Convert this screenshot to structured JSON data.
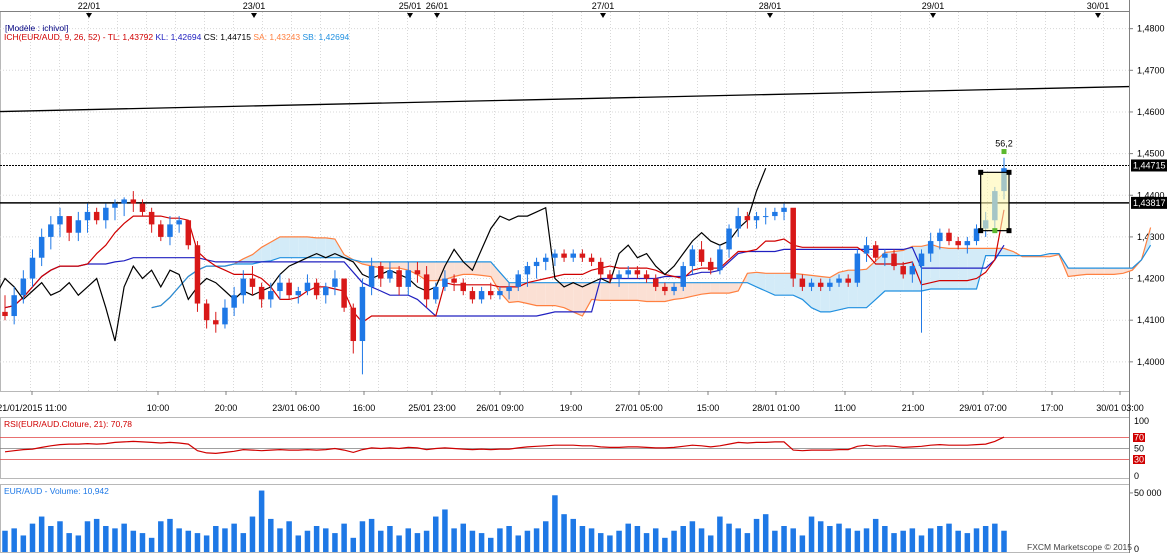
{
  "chart_data": [
    {
      "type": "candlestick",
      "title": "",
      "info_lines": [
        {
          "parts": [
            {
              "text": "[Modèle : ichivol]",
              "color": "#000080"
            }
          ]
        },
        {
          "parts": [
            {
              "text": "ICH(EUR/AUD, 9, 26, 52) - TL: 1,43792",
              "color": "#d00000"
            },
            {
              "text": "KL: 1,42694",
              "color": "#2020c0"
            },
            {
              "text": "CS: 1,44715",
              "color": "#000000"
            },
            {
              "text": "SA: 1,43243",
              "color": "#ff8040"
            },
            {
              "text": "SB: 1,42694",
              "color": "#2090e0"
            }
          ]
        }
      ],
      "top_dates": [
        "22/01",
        "23/01",
        "25/01",
        "26/01",
        "27/01",
        "28/01",
        "29/01",
        "30/01"
      ],
      "x_time_labels": [
        "21/01/2015 11:00",
        "10:00",
        "20:00",
        "23/01 06:00",
        "16:00",
        "25/01 23:00",
        "26/01 09:00",
        "19:00",
        "27/01 05:00",
        "15:00",
        "28/01 01:00",
        "11:00",
        "21:00",
        "29/01 07:00",
        "17:00",
        "30/01 03:00"
      ],
      "y_ticks": [
        "1,4800",
        "1,4700",
        "1,4600",
        "1,4500",
        "1,4400",
        "1,4300",
        "1,4200",
        "1,4100",
        "1,4000"
      ],
      "y_tick_values": [
        1.48,
        1.47,
        1.46,
        1.45,
        1.44,
        1.43,
        1.42,
        1.41,
        1.4
      ],
      "ylim": [
        1.393,
        1.484
      ],
      "price_tags": [
        {
          "text": "1,44715",
          "value": 1.44715,
          "bg": "#000000",
          "fg": "#ffffff"
        },
        {
          "text": "1,43817",
          "value": 1.43817,
          "bg": "#000000",
          "fg": "#ffffff"
        }
      ],
      "annotation": {
        "text": "56,2",
        "value": 1.4515
      },
      "horizontal_lines": [
        1.44715,
        1.43817
      ],
      "trendline": {
        "from": 1.4601,
        "to": 1.4661
      },
      "colors": {
        "up": "#1e78e6",
        "down": "#d81818",
        "tenkan": "#d00000",
        "kijun": "#2020c0",
        "chikou": "#000000",
        "span_a": "#ff8040",
        "span_b": "#2090e0",
        "cloud_bull": "#d3ebf8",
        "cloud_bear": "#fbe0d4"
      },
      "candles_ohlc": [
        [
          1.412,
          1.416,
          1.41,
          1.411
        ],
        [
          1.411,
          1.418,
          1.409,
          1.416
        ],
        [
          1.416,
          1.422,
          1.414,
          1.42
        ],
        [
          1.42,
          1.427,
          1.418,
          1.425
        ],
        [
          1.425,
          1.432,
          1.423,
          1.43
        ],
        [
          1.43,
          1.435,
          1.427,
          1.433
        ],
        [
          1.433,
          1.437,
          1.43,
          1.435
        ],
        [
          1.435,
          1.433,
          1.429,
          1.431
        ],
        [
          1.431,
          1.436,
          1.429,
          1.434
        ],
        [
          1.434,
          1.438,
          1.431,
          1.436
        ],
        [
          1.436,
          1.437,
          1.433,
          1.434
        ],
        [
          1.434,
          1.438,
          1.432,
          1.437
        ],
        [
          1.437,
          1.439,
          1.434,
          1.438
        ],
        [
          1.438,
          1.4395,
          1.435,
          1.439
        ],
        [
          1.439,
          1.441,
          1.436,
          1.438
        ],
        [
          1.438,
          1.439,
          1.435,
          1.436
        ],
        [
          1.436,
          1.437,
          1.431,
          1.433
        ],
        [
          1.433,
          1.434,
          1.429,
          1.43
        ],
        [
          1.43,
          1.435,
          1.428,
          1.433
        ],
        [
          1.433,
          1.435,
          1.431,
          1.434
        ],
        [
          1.434,
          1.433,
          1.427,
          1.428
        ],
        [
          1.428,
          1.429,
          1.412,
          1.414
        ],
        [
          1.414,
          1.415,
          1.408,
          1.41
        ],
        [
          1.41,
          1.412,
          1.407,
          1.409
        ],
        [
          1.409,
          1.415,
          1.408,
          1.413
        ],
        [
          1.413,
          1.418,
          1.411,
          1.416
        ],
        [
          1.416,
          1.422,
          1.414,
          1.42
        ],
        [
          1.42,
          1.423,
          1.416,
          1.418
        ],
        [
          1.418,
          1.419,
          1.413,
          1.415
        ],
        [
          1.415,
          1.419,
          1.413,
          1.417
        ],
        [
          1.417,
          1.421,
          1.415,
          1.419
        ],
        [
          1.419,
          1.42,
          1.415,
          1.416
        ],
        [
          1.416,
          1.418,
          1.414,
          1.417
        ],
        [
          1.417,
          1.421,
          1.416,
          1.419
        ],
        [
          1.419,
          1.42,
          1.415,
          1.416
        ],
        [
          1.416,
          1.419,
          1.414,
          1.418
        ],
        [
          1.418,
          1.422,
          1.416,
          1.42
        ],
        [
          1.42,
          1.419,
          1.412,
          1.413
        ],
        [
          1.413,
          1.414,
          1.402,
          1.405
        ],
        [
          1.405,
          1.42,
          1.397,
          1.418
        ],
        [
          1.418,
          1.425,
          1.416,
          1.423
        ],
        [
          1.423,
          1.424,
          1.418,
          1.42
        ],
        [
          1.42,
          1.424,
          1.419,
          1.422
        ],
        [
          1.422,
          1.423,
          1.416,
          1.418
        ],
        [
          1.418,
          1.424,
          1.416,
          1.422
        ],
        [
          1.422,
          1.424,
          1.419,
          1.421
        ],
        [
          1.421,
          1.423,
          1.413,
          1.415
        ],
        [
          1.415,
          1.419,
          1.414,
          1.418
        ],
        [
          1.418,
          1.422,
          1.417,
          1.42
        ],
        [
          1.42,
          1.421,
          1.417,
          1.419
        ],
        [
          1.419,
          1.42,
          1.416,
          1.417
        ],
        [
          1.417,
          1.418,
          1.414,
          1.415
        ],
        [
          1.415,
          1.418,
          1.414,
          1.417
        ],
        [
          1.417,
          1.419,
          1.415,
          1.416
        ],
        [
          1.416,
          1.418,
          1.415,
          1.417
        ],
        [
          1.417,
          1.419,
          1.415,
          1.418
        ],
        [
          1.418,
          1.422,
          1.417,
          1.421
        ],
        [
          1.421,
          1.424,
          1.418,
          1.423
        ],
        [
          1.423,
          1.425,
          1.42,
          1.424
        ],
        [
          1.424,
          1.426,
          1.422,
          1.425
        ],
        [
          1.425,
          1.427,
          1.423,
          1.426
        ],
        [
          1.426,
          1.427,
          1.424,
          1.425
        ],
        [
          1.425,
          1.427,
          1.424,
          1.426
        ],
        [
          1.426,
          1.427,
          1.424,
          1.425
        ],
        [
          1.425,
          1.426,
          1.423,
          1.424
        ],
        [
          1.424,
          1.425,
          1.42,
          1.421
        ],
        [
          1.421,
          1.422,
          1.419,
          1.42
        ],
        [
          1.42,
          1.422,
          1.418,
          1.421
        ],
        [
          1.421,
          1.423,
          1.42,
          1.422
        ],
        [
          1.422,
          1.423,
          1.42,
          1.421
        ],
        [
          1.421,
          1.422,
          1.419,
          1.42
        ],
        [
          1.42,
          1.421,
          1.417,
          1.418
        ],
        [
          1.418,
          1.419,
          1.416,
          1.417
        ],
        [
          1.417,
          1.419,
          1.416,
          1.418
        ],
        [
          1.418,
          1.424,
          1.417,
          1.423
        ],
        [
          1.423,
          1.428,
          1.421,
          1.427
        ],
        [
          1.427,
          1.429,
          1.423,
          1.424
        ],
        [
          1.424,
          1.425,
          1.421,
          1.422
        ],
        [
          1.422,
          1.428,
          1.421,
          1.427
        ],
        [
          1.427,
          1.433,
          1.425,
          1.432
        ],
        [
          1.432,
          1.437,
          1.43,
          1.435
        ],
        [
          1.435,
          1.436,
          1.432,
          1.434
        ],
        [
          1.434,
          1.436,
          1.432,
          1.435
        ],
        [
          1.435,
          1.437,
          1.433,
          1.435
        ],
        [
          1.435,
          1.437,
          1.434,
          1.436
        ],
        [
          1.436,
          1.438,
          1.434,
          1.437
        ],
        [
          1.437,
          1.435,
          1.418,
          1.42
        ],
        [
          1.42,
          1.421,
          1.417,
          1.418
        ],
        [
          1.418,
          1.42,
          1.417,
          1.419
        ],
        [
          1.419,
          1.42,
          1.417,
          1.418
        ],
        [
          1.418,
          1.42,
          1.417,
          1.419
        ],
        [
          1.419,
          1.421,
          1.418,
          1.42
        ],
        [
          1.42,
          1.421,
          1.418,
          1.419
        ],
        [
          1.419,
          1.427,
          1.418,
          1.426
        ],
        [
          1.426,
          1.43,
          1.424,
          1.428
        ],
        [
          1.428,
          1.429,
          1.424,
          1.425
        ],
        [
          1.425,
          1.427,
          1.423,
          1.426
        ],
        [
          1.426,
          1.427,
          1.422,
          1.423
        ],
        [
          1.423,
          1.424,
          1.42,
          1.421
        ],
        [
          1.421,
          1.424,
          1.419,
          1.423
        ],
        [
          1.423,
          1.427,
          1.407,
          1.426
        ],
        [
          1.426,
          1.431,
          1.424,
          1.429
        ],
        [
          1.429,
          1.432,
          1.427,
          1.431
        ],
        [
          1.431,
          1.432,
          1.428,
          1.429
        ],
        [
          1.429,
          1.43,
          1.427,
          1.428
        ],
        [
          1.428,
          1.43,
          1.426,
          1.429
        ],
        [
          1.429,
          1.433,
          1.428,
          1.432
        ],
        [
          1.432,
          1.436,
          1.43,
          1.434
        ],
        [
          1.434,
          1.442,
          1.432,
          1.441
        ],
        [
          1.441,
          1.449,
          1.439,
          1.4465
        ]
      ],
      "volume_values": [
        18,
        20,
        14,
        24,
        30,
        22,
        26,
        16,
        14,
        26,
        28,
        22,
        20,
        24,
        18,
        16,
        12,
        26,
        28,
        20,
        18,
        16,
        14,
        22,
        20,
        24,
        16,
        30,
        52,
        28,
        20,
        26,
        14,
        18,
        22,
        20,
        16,
        24,
        12,
        26,
        28,
        18,
        22,
        14,
        20,
        16,
        18,
        30,
        36,
        20,
        24,
        18,
        16,
        12,
        20,
        22,
        14,
        18,
        20,
        26,
        48,
        32,
        28,
        22,
        20,
        16,
        14,
        18,
        24,
        22,
        16,
        20,
        12,
        18,
        22,
        26,
        20,
        14,
        30,
        24,
        20,
        16,
        28,
        32,
        18,
        22,
        20,
        14,
        30,
        26,
        22,
        24,
        20,
        18,
        20,
        28,
        22,
        16,
        18,
        20,
        14,
        20,
        22,
        24,
        18,
        16,
        20,
        22,
        24,
        18,
        16,
        12,
        22,
        20,
        12
      ],
      "volume_label": "EUR/AUD - Volume: 10,942",
      "volume_ticks": [
        "50 000",
        "0"
      ],
      "rsi": {
        "label": "RSI(EUR/AUD.Cloture, 21): 70,78",
        "ticks": [
          "100",
          "70",
          "50",
          "30",
          "0"
        ],
        "levels": [
          70,
          50,
          30
        ],
        "values": [
          44,
          46,
          48,
          49,
          52,
          55,
          57,
          58,
          58,
          59,
          58,
          59,
          61,
          62,
          63,
          62,
          61,
          60,
          61,
          60,
          58,
          46,
          42,
          41,
          43,
          45,
          48,
          47,
          46,
          47,
          48,
          47,
          47,
          48,
          47,
          48,
          50,
          47,
          43,
          48,
          51,
          50,
          51,
          50,
          52,
          51,
          48,
          50,
          51,
          50,
          49,
          48,
          49,
          48,
          49,
          49,
          51,
          53,
          54,
          55,
          56,
          56,
          56,
          55,
          55,
          53,
          52,
          52,
          53,
          53,
          52,
          51,
          51,
          52,
          54,
          56,
          55,
          53,
          55,
          58,
          61,
          60,
          61,
          61,
          62,
          62,
          47,
          46,
          47,
          47,
          47,
          48,
          48,
          54,
          56,
          54,
          55,
          54,
          52,
          53,
          54,
          56,
          57,
          56,
          56,
          56,
          57,
          58,
          63,
          70.78
        ]
      },
      "footer": "FXCM Marketscope © 2015"
    }
  ]
}
